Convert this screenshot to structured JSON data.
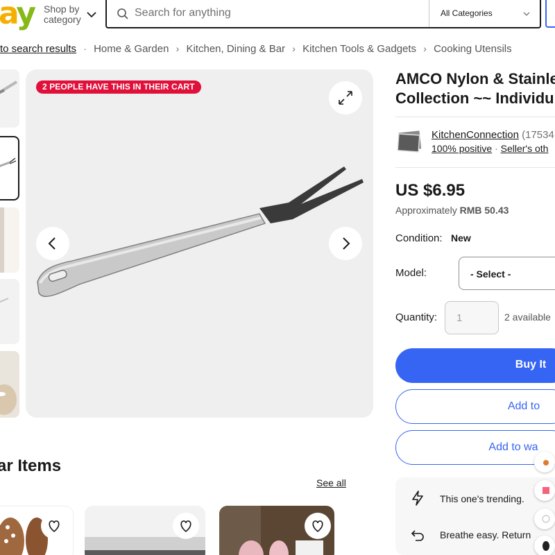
{
  "header": {
    "logo_letter_a": "a",
    "logo_letter_y": "y",
    "shop_by_line1": "Shop by",
    "shop_by_line2": "category",
    "search_placeholder": "Search for anything",
    "category_selected": "All Categories"
  },
  "breadcrumb": {
    "back_label": "to search results",
    "items": [
      "Home & Garden",
      "Kitchen, Dining & Bar",
      "Kitchen Tools & Gadgets",
      "Cooking Utensils"
    ]
  },
  "gallery": {
    "cart_badge": "2 PEOPLE HAVE THIS IN THEIR CART"
  },
  "product": {
    "title_line1": "AMCO Nylon & Stainle",
    "title_line2": "Collection ~~ Individu",
    "seller_name": "KitchenConnection",
    "seller_count": "(17534",
    "seller_positive": "100% positive",
    "seller_other": "Seller's oth",
    "price": "US $6.95",
    "approx_prefix": "Approximately",
    "approx_value": "RMB 50.43",
    "condition_label": "Condition:",
    "condition_value": "New",
    "model_label": "Model:",
    "model_selected": "- Select -",
    "quantity_label": "Quantity:",
    "quantity_value": "1",
    "quantity_available": "2 available",
    "buy_label": "Buy It",
    "cart_label": "Add to",
    "watch_label": "Add to wa"
  },
  "promos": [
    {
      "icon": "lightning-icon",
      "text": "This one's trending."
    },
    {
      "icon": "return-icon",
      "text": "Breathe easy. Return"
    }
  ],
  "similar": {
    "title": "ar Items",
    "see_all": "See all"
  },
  "colors": {
    "accent_blue": "#3665f3",
    "badge_red": "#e0103a",
    "logo_yellow": "#f5af02",
    "logo_green": "#86b817"
  }
}
